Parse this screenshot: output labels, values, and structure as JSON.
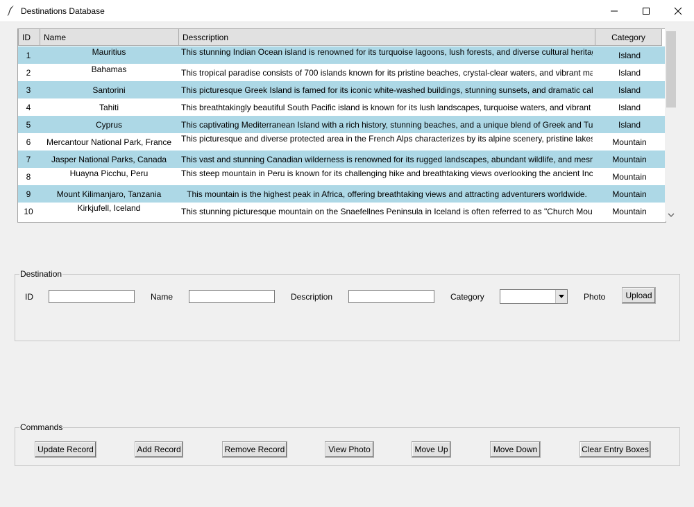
{
  "window": {
    "title": "Destinations Database",
    "app_icon": "feather-icon"
  },
  "table": {
    "columns": [
      "ID",
      "Name",
      "Desscription",
      "Category"
    ],
    "rows": [
      {
        "id": "1",
        "name": "Mauritius",
        "description": "This stunning Indian Ocean island is renowned for its turquoise lagoons, lush forests, and diverse cultural heritag",
        "category": "Island"
      },
      {
        "id": "2",
        "name": "Bahamas",
        "description": "This tropical paradise consists of 700 islands known for its pristine beaches, crystal-clear waters, and vibrant mari",
        "category": "Island"
      },
      {
        "id": "3",
        "name": "Santorini",
        "description": "This picturesque Greek Island is famed for its iconic white-washed buildings, stunning sunsets, and dramatic calc",
        "category": "Island"
      },
      {
        "id": "4",
        "name": "Tahiti",
        "description": "This breathtakingly beautiful South Pacific island is known for its lush landscapes, turquoise waters, and vibrant P",
        "category": "Island"
      },
      {
        "id": "5",
        "name": "Cyprus",
        "description": "This captivating Mediterranean Island with a rich history, stunning beaches, and a unique blend of Greek and Tur",
        "category": "Island"
      },
      {
        "id": "6",
        "name": "Mercantour National Park, France",
        "description": "This picturesque and diverse protected area in the French Alps characterizes by its alpine scenery, pristine lakes, a",
        "category": "Mountain"
      },
      {
        "id": "7",
        "name": "Jasper National Parks, Canada",
        "description": "This vast and stunning Canadian wilderness is renowned for its rugged landscapes, abundant wildlife, and mesm",
        "category": "Mountain"
      },
      {
        "id": "8",
        "name": "Huayna Picchu, Peru",
        "description": "This steep mountain in Peru is known for its challenging hike and breathtaking views overlooking the ancient Inc",
        "category": "Mountain"
      },
      {
        "id": "9",
        "name": "Mount Kilimanjaro, Tanzania",
        "description": "This mountain is the highest peak in Africa, offering breathtaking views and attracting adventurers worldwide.",
        "category": "Mountain"
      },
      {
        "id": "10",
        "name": "Kirkjufell, Iceland",
        "description": "This stunning picturesque mountain on the Snaefellnes Peninsula in Iceland is often referred to as \"Church Mour",
        "category": "Mountain"
      }
    ]
  },
  "destination": {
    "legend": "Destination",
    "id_label": "ID",
    "id_value": "",
    "name_label": "Name",
    "name_value": "",
    "description_label": "Description",
    "description_value": "",
    "category_label": "Category",
    "category_value": "",
    "photo_label": "Photo",
    "upload_button": "Upload"
  },
  "commands": {
    "legend": "Commands",
    "update": "Update Record",
    "add": "Add Record",
    "remove": "Remove Record",
    "view_photo": "View Photo",
    "move_up": "Move Up",
    "move_down": "Move Down",
    "clear": "Clear Entry Boxes"
  },
  "colors": {
    "row_highlight": "#add8e6",
    "row_plain": "#ffffff",
    "header_bg": "#e1e1e1"
  }
}
